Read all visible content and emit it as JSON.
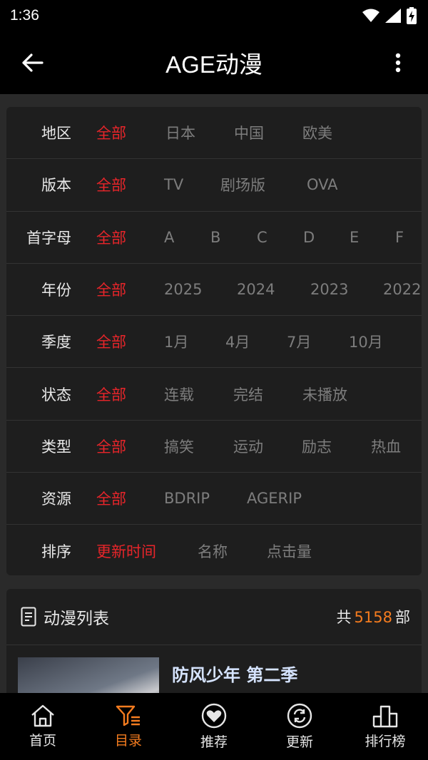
{
  "status": {
    "time": "1:36"
  },
  "appbar": {
    "title": "AGE动漫"
  },
  "filters": [
    {
      "label": "地区",
      "options": [
        "全部",
        "日本",
        "中国",
        "欧美"
      ],
      "active": 0
    },
    {
      "label": "版本",
      "options": [
        "全部",
        "TV",
        "剧场版",
        "OVA"
      ],
      "active": 0
    },
    {
      "label": "首字母",
      "options": [
        "全部",
        "A",
        "B",
        "C",
        "D",
        "E",
        "F"
      ],
      "active": 0
    },
    {
      "label": "年份",
      "options": [
        "全部",
        "2025",
        "2024",
        "2023",
        "2022"
      ],
      "active": 0
    },
    {
      "label": "季度",
      "options": [
        "全部",
        "1月",
        "4月",
        "7月",
        "10月"
      ],
      "active": 0
    },
    {
      "label": "状态",
      "options": [
        "全部",
        "连载",
        "完结",
        "未播放"
      ],
      "active": 0
    },
    {
      "label": "类型",
      "options": [
        "全部",
        "搞笑",
        "运动",
        "励志",
        "热血"
      ],
      "active": 0
    },
    {
      "label": "资源",
      "options": [
        "全部",
        "BDRIP",
        "AGERIP"
      ],
      "active": 0
    },
    {
      "label": "排序",
      "options": [
        "更新时间",
        "名称",
        "点击量"
      ],
      "active": 0
    }
  ],
  "list": {
    "title": "动漫列表",
    "count_prefix": "共",
    "count": "5158",
    "count_suffix": "部",
    "items": [
      {
        "title": "防风少年 第二季"
      }
    ]
  },
  "nav": {
    "items": [
      {
        "label": "首页",
        "icon": "home-icon"
      },
      {
        "label": "目录",
        "icon": "filter-list-icon"
      },
      {
        "label": "推荐",
        "icon": "heart-icon"
      },
      {
        "label": "更新",
        "icon": "refresh-icon"
      },
      {
        "label": "排行榜",
        "icon": "podium-icon"
      }
    ],
    "active": 1
  },
  "colors": {
    "accent": "#e8252a",
    "orange": "#f57c1f",
    "inactive": "#7d7d7d"
  }
}
